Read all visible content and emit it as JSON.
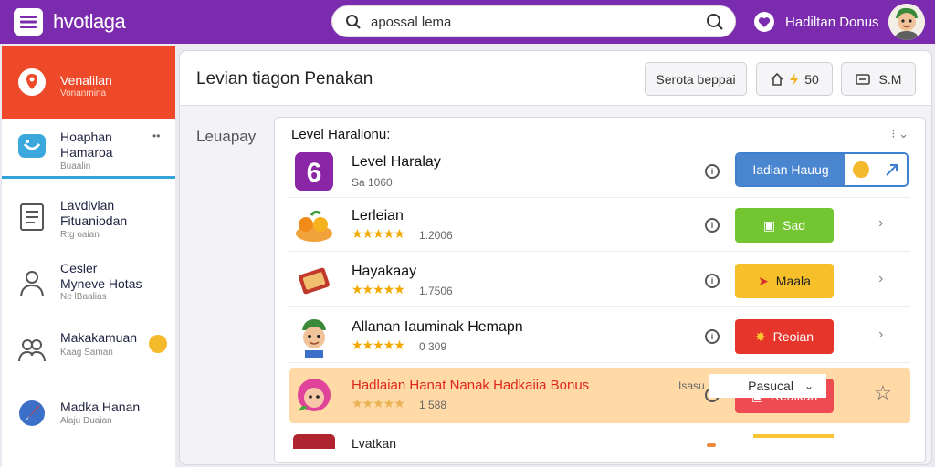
{
  "topbar": {
    "app_title": "hvotlaga",
    "search_value": "apossal lema",
    "bonus_label": "Hadiltan Donus"
  },
  "sidebar": {
    "items": [
      {
        "line1": "Venalilan",
        "line2": "",
        "line3": "Vonanmina"
      },
      {
        "line1": "Hoaphan",
        "line2": "Hamaroa",
        "line3": "Buaalin"
      },
      {
        "line1": "Lavdivlan",
        "line2": "Fituaniodan",
        "line3": "Rtg oaian"
      },
      {
        "line1": "Cesler",
        "line2": "Myneve Hotas",
        "line3": "Ne lBaalias"
      },
      {
        "line1": "Makakamuan",
        "line2": "",
        "line3": "Kaag Saman"
      },
      {
        "line1": "Madka Hanan",
        "line2": "",
        "line3": "Alaju Duaian"
      }
    ]
  },
  "header": {
    "title": "Levian tiagon Penakan",
    "search_btn": "Serota beppai",
    "coins_value": "50",
    "cash_value": "S.M"
  },
  "main": {
    "side_label": "Leuapay"
  },
  "list": {
    "title": "Level Haralionu:",
    "rows": [
      {
        "name": "Level Haralay",
        "sub": "Sa 1060",
        "action": "Iadian Hauug"
      },
      {
        "name": "Lerleian",
        "count": "1.2006",
        "action": "Sad"
      },
      {
        "name": "Hayakaay",
        "count": "1.7506",
        "action": "Maala"
      },
      {
        "name": "Allanan Iauminak Hemapn",
        "count": "0 309",
        "action": "Reoian"
      },
      {
        "name": "Hadlaian Hanat Nanak Hadkaiia Bonus",
        "count": "1 588",
        "action": "Reaikan"
      }
    ],
    "footer_name": "Lvatkan",
    "footer_small": "Isasu",
    "sort_label": "Pasucal"
  },
  "colors": {
    "topbar": "#7b2cae",
    "active_side": "#ee4a2a",
    "green": "#73c531",
    "yellow": "#f7bf2a",
    "red": "#e6352b",
    "salmon": "#ee4c52",
    "blue": "#4a86cf",
    "highlight": "#ffd9a6"
  }
}
